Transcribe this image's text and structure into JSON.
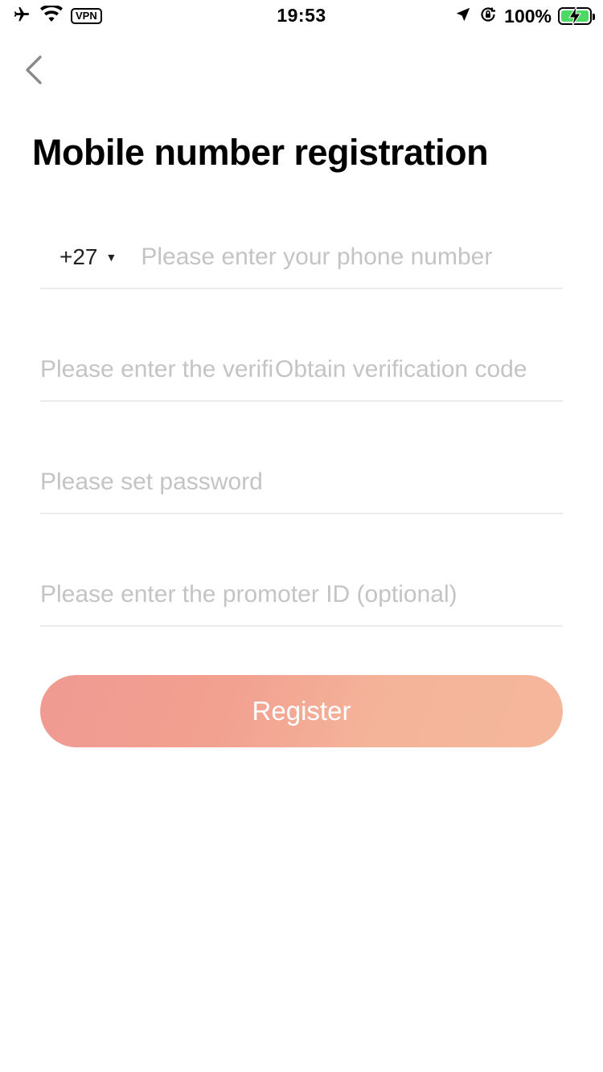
{
  "status_bar": {
    "vpn_label": "VPN",
    "time": "19:53",
    "battery_percent": "100%",
    "battery_level": 1.0,
    "battery_color": "#4cd964"
  },
  "icons": {
    "airplane": "airplane-icon",
    "wifi": "wifi-icon",
    "location": "location-arrow-icon",
    "orientation_lock": "orientation-lock-icon",
    "back": "chevron-left-icon",
    "dropdown": "caret-down-icon"
  },
  "page": {
    "title": "Mobile number registration"
  },
  "form": {
    "country_code": "+27",
    "dropdown_glyph": "▼",
    "phone_placeholder": "Please enter your phone number",
    "code_placeholder": "Please enter the verification code",
    "obtain_code_label": "Obtain verification code",
    "password_placeholder": "Please set password",
    "promoter_placeholder": "Please enter the promoter ID (optional)",
    "register_label": "Register"
  },
  "colors": {
    "placeholder": "#c4c4c4",
    "divider": "#ececec",
    "button_gradient_start": "#f09a92",
    "button_gradient_end": "#f5b79c"
  }
}
